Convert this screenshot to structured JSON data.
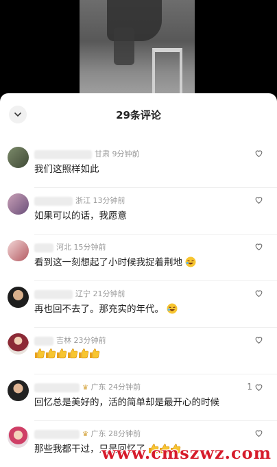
{
  "video": {},
  "panel": {
    "title": "29条评论"
  },
  "comments": [
    {
      "location": "甘肃",
      "time": "9分钟前",
      "text": "我们这照样如此",
      "likes": ""
    },
    {
      "location": "浙江",
      "time": "13分钟前",
      "text": "如果可以的话，我愿意",
      "likes": ""
    },
    {
      "location": "河北",
      "time": "15分钟前",
      "text": "看到这一刻想起了小时候我捉着荆地",
      "likes": ""
    },
    {
      "location": "辽宁",
      "time": "21分钟前",
      "text": "再也回不去了。那充实的年代。",
      "likes": ""
    },
    {
      "location": "吉林",
      "time": "23分钟前",
      "text": "",
      "likes": ""
    },
    {
      "location": "广东",
      "time": "24分钟前",
      "text": "回忆总是美好的，活的简单却是最开心的时候",
      "likes": "1"
    },
    {
      "location": "广东",
      "time": "28分钟前",
      "text": "那些我都干过，只是回忆了",
      "likes": ""
    }
  ],
  "icons": {
    "collapse": "chevron-down-icon",
    "like": "heart-outline-icon",
    "thumbs": "thumbs-up-emoji",
    "laugh": "laughing-emoji"
  },
  "watermark": "www.cmszwz.com"
}
